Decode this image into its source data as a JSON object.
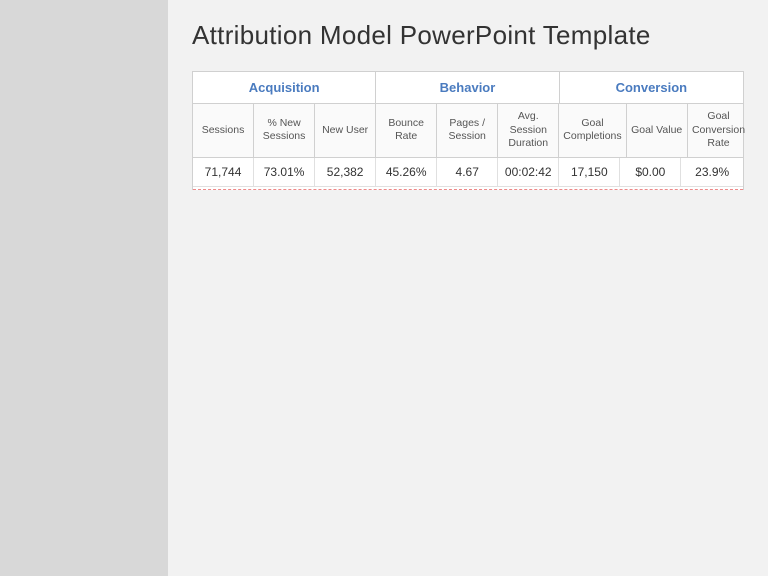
{
  "page": {
    "title": "Attribution Model PowerPoint Template"
  },
  "table": {
    "groups": [
      {
        "label": "Acquisition",
        "cols": 3
      },
      {
        "label": "Behavior",
        "cols": 3
      },
      {
        "label": "Conversion",
        "cols": 3
      }
    ],
    "columns": [
      {
        "key": "sessions",
        "label": "Sessions",
        "group": "acquisition"
      },
      {
        "key": "pct_new",
        "label": "% New\nSessions",
        "group": "acquisition"
      },
      {
        "key": "new_user",
        "label": "New User",
        "group": "acquisition"
      },
      {
        "key": "bounce_rate",
        "label": "Bounce Rate",
        "group": "behavior"
      },
      {
        "key": "pages_session",
        "label": "Pages /\nSession",
        "group": "behavior"
      },
      {
        "key": "avg_session",
        "label": "Avg. Session\nDuration",
        "group": "behavior"
      },
      {
        "key": "goal_comp",
        "label": "Goal\nCompletions",
        "group": "conversion"
      },
      {
        "key": "goal_value",
        "label": "Goal Value",
        "group": "conversion"
      },
      {
        "key": "goal_conv",
        "label": "Goal\nConversion\nRate",
        "group": "conversion"
      }
    ],
    "rows": [
      {
        "sessions": "71,744",
        "pct_new": "73.01%",
        "new_user": "52,382",
        "bounce_rate": "45.26%",
        "pages_session": "4.67",
        "avg_session": "00:02:42",
        "goal_comp": "17,150",
        "goal_value": "$0.00",
        "goal_conv": "23.9%"
      }
    ]
  }
}
